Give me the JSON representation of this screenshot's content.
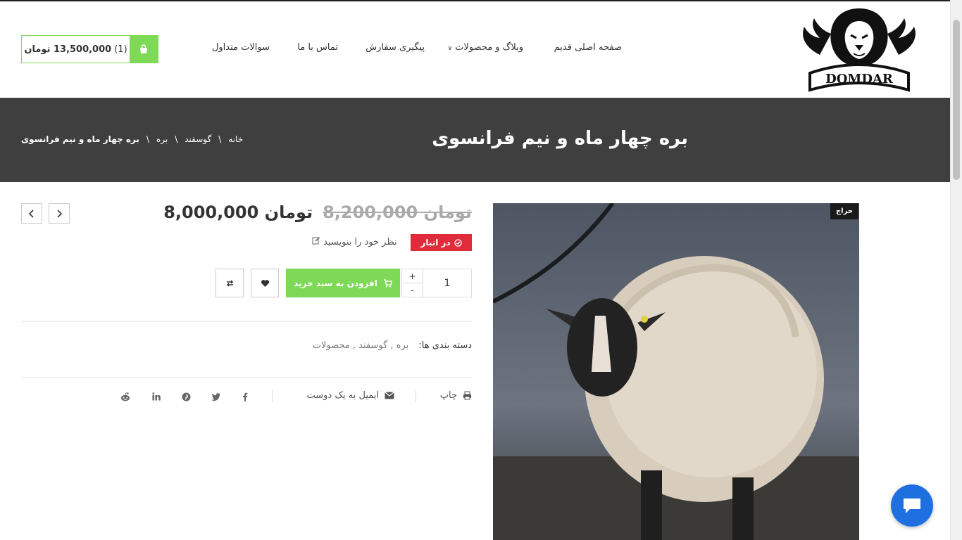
{
  "header": {
    "logo_text": "DOMDAR",
    "nav": [
      {
        "label": "صفحه اصلی قدیم"
      },
      {
        "label": "وبلاگ و محصولات"
      },
      {
        "label": "پیگیری سفارش"
      },
      {
        "label": "تماس با ما"
      },
      {
        "label": "سوالات متداول"
      }
    ],
    "cart": {
      "count": "(1)",
      "total": "13,500,000 تومان"
    }
  },
  "band": {
    "title": "بره چهار ماه و نیم فرانسوی",
    "breadcrumb": [
      "خانه",
      "گوسفند",
      "بره",
      "بره چهار ماه و نیم فرانسوی"
    ],
    "separator": "\\"
  },
  "product": {
    "sale_badge": "حراج",
    "old_price": "8,200,000 تومان",
    "new_price": "8,000,000 تومان",
    "stock_label": "در انبار",
    "review_link": "نظر خود را بنویسید",
    "quantity": "1",
    "qty_plus": "+",
    "qty_minus": "-",
    "add_to_cart": "افزودن به سبد خرید",
    "categories_label": "دسته بندی ها:",
    "categories_value": "بره , گوسفند , محصولات",
    "print_label": "چاپ",
    "email_label": "ایمیل به یک دوست"
  },
  "colors": {
    "accent_green": "#7ed957",
    "stock_red": "#e02b3b",
    "band_dark": "#3f3f3f",
    "chat_blue": "#1e6fe0"
  },
  "icons": [
    "cart-bag-icon",
    "chevron-left-icon",
    "chevron-right-icon",
    "check-circle-icon",
    "edit-icon",
    "cart-icon",
    "heart-icon",
    "compare-icon",
    "print-icon",
    "envelope-icon",
    "facebook-icon",
    "twitter-icon",
    "pinterest-icon",
    "linkedin-icon",
    "reddit-icon",
    "chat-icon"
  ]
}
